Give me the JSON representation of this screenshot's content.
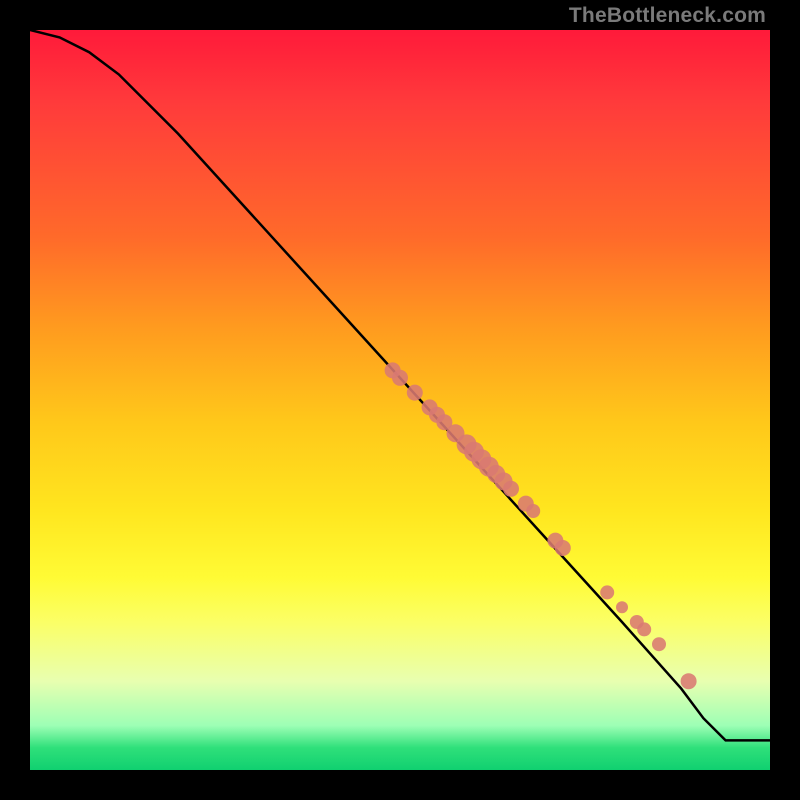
{
  "watermark": "TheBottleneck.com",
  "chart_data": {
    "type": "line",
    "title": "",
    "xlabel": "",
    "ylabel": "",
    "xlim": [
      0,
      100
    ],
    "ylim": [
      0,
      100
    ],
    "grid": false,
    "legend": false,
    "curve": [
      {
        "x": 0,
        "y": 100
      },
      {
        "x": 4,
        "y": 99
      },
      {
        "x": 8,
        "y": 97
      },
      {
        "x": 12,
        "y": 94
      },
      {
        "x": 16,
        "y": 90
      },
      {
        "x": 20,
        "y": 86
      },
      {
        "x": 30,
        "y": 75
      },
      {
        "x": 40,
        "y": 64
      },
      {
        "x": 50,
        "y": 53
      },
      {
        "x": 60,
        "y": 42
      },
      {
        "x": 70,
        "y": 31
      },
      {
        "x": 80,
        "y": 20
      },
      {
        "x": 88,
        "y": 11
      },
      {
        "x": 91,
        "y": 7
      },
      {
        "x": 93,
        "y": 5
      },
      {
        "x": 94,
        "y": 4
      },
      {
        "x": 100,
        "y": 4
      }
    ],
    "series": [
      {
        "name": "points",
        "color": "#d97a72",
        "points": [
          {
            "x": 49,
            "y": 54,
            "r": 8
          },
          {
            "x": 50,
            "y": 53,
            "r": 8
          },
          {
            "x": 52,
            "y": 51,
            "r": 8
          },
          {
            "x": 54,
            "y": 49,
            "r": 8
          },
          {
            "x": 55,
            "y": 48,
            "r": 8
          },
          {
            "x": 56,
            "y": 47,
            "r": 8
          },
          {
            "x": 57.5,
            "y": 45.5,
            "r": 9
          },
          {
            "x": 59,
            "y": 44,
            "r": 10
          },
          {
            "x": 60,
            "y": 43,
            "r": 10
          },
          {
            "x": 61,
            "y": 42,
            "r": 10
          },
          {
            "x": 62,
            "y": 41,
            "r": 10
          },
          {
            "x": 63,
            "y": 40,
            "r": 9
          },
          {
            "x": 64,
            "y": 39,
            "r": 9
          },
          {
            "x": 65,
            "y": 38,
            "r": 8
          },
          {
            "x": 67,
            "y": 36,
            "r": 8
          },
          {
            "x": 68,
            "y": 35,
            "r": 7
          },
          {
            "x": 71,
            "y": 31,
            "r": 8
          },
          {
            "x": 72,
            "y": 30,
            "r": 8
          },
          {
            "x": 78,
            "y": 24,
            "r": 7
          },
          {
            "x": 80,
            "y": 22,
            "r": 6
          },
          {
            "x": 82,
            "y": 20,
            "r": 7
          },
          {
            "x": 83,
            "y": 19,
            "r": 7
          },
          {
            "x": 85,
            "y": 17,
            "r": 7
          },
          {
            "x": 89,
            "y": 12,
            "r": 8
          }
        ]
      }
    ]
  }
}
